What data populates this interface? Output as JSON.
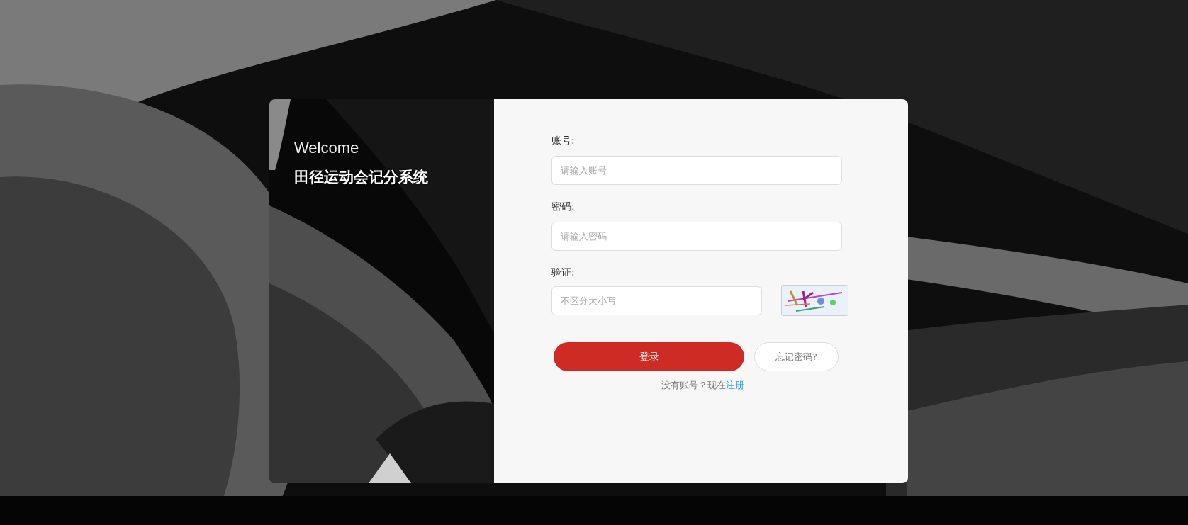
{
  "side_panel": {
    "greeting": "Welcome",
    "title": "田径运动会记分系统"
  },
  "form": {
    "fields": [
      {
        "kind": "text",
        "label": "账号:",
        "placeholder": "请输入账号"
      },
      {
        "kind": "password",
        "label": "密码:",
        "placeholder": "请输入密码"
      },
      {
        "kind": "captcha",
        "label": "验证:",
        "placeholder": "不区分大小写"
      }
    ],
    "login_button": "登录",
    "forgot_button": "忘记密码?",
    "register_prompt": "没有账号？现在",
    "register_link": "注册"
  }
}
